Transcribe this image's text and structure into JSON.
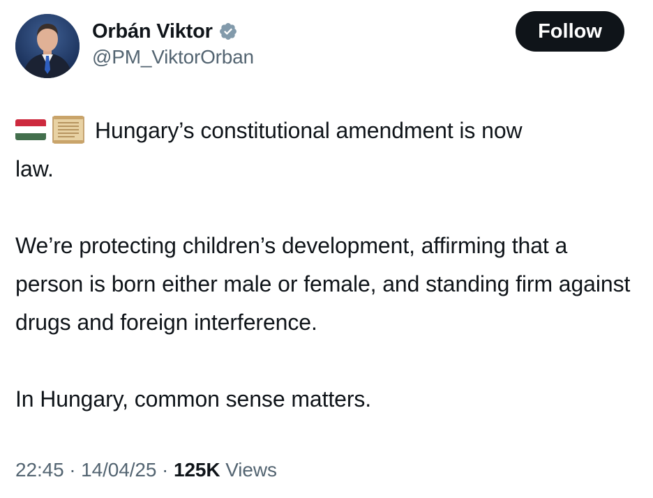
{
  "author": {
    "display_name": "Orbán Viktor",
    "handle": "@PM_ViktorOrban",
    "verified_icon": "verified-badge-icon",
    "verified_color": "#829aab"
  },
  "follow": {
    "label": "Follow"
  },
  "tweet": {
    "emojis": [
      "hungary-flag-emoji",
      "scroll-emoji"
    ],
    "line1": "Hungary’s constitutional amendment is now",
    "line1_wrap": "law.",
    "para2": "We’re protecting children’s development, affirming that a person is born either male or female, and standing firm against drugs and foreign interference.",
    "para3": "In Hungary, common sense matters."
  },
  "meta": {
    "time": "22:45",
    "sep1": " · ",
    "date": "14/04/25",
    "sep2": " · ",
    "views_count": "125K",
    "views_label": " Views"
  },
  "colors": {
    "text": "#0f1419",
    "secondary": "#536471",
    "button_bg": "#0f1419",
    "button_text": "#ffffff",
    "flag_red": "#cd2a3e",
    "flag_white": "#ffffff",
    "flag_green": "#436f4d"
  }
}
